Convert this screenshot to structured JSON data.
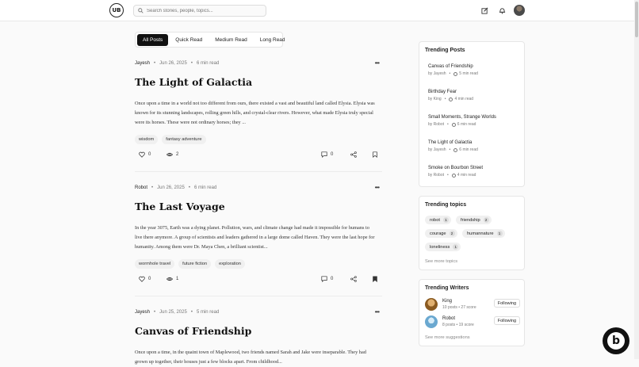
{
  "header": {
    "logo_text": "UB",
    "search_placeholder": "Search stories, people, topics..."
  },
  "filters": [
    "All Posts",
    "Quick Read",
    "Medium Read",
    "Long Read"
  ],
  "posts": [
    {
      "author": "Jayesh",
      "date": "Jun 26, 2025",
      "read": "6 min read",
      "title": "The Light of Galactia",
      "excerpt": "Once upon a time in a world not too different from ours, there existed a vast and beautiful land called Elysia. Elysia was known for its stunning landscapes, rolling green hills, and crystal-clear rivers. However, what made Elysia truly special were its horses. These were not ordinary horses; they ...",
      "tags": [
        "wisdom",
        "fantasy adventure"
      ],
      "likes": "0",
      "views": "2",
      "comments": "0"
    },
    {
      "author": "Robot",
      "date": "Jun 26, 2025",
      "read": "6 min read",
      "title": "The Last Voyage",
      "excerpt": "In the year 3075, Earth was a dying planet. Pollution, wars, and climate change had made it impossible for humans to live there anymore. A group of scientists and leaders gathered in a large dome called Haven. They were the last hope for humanity. Among them were Dr. Maya Chen, a brilliant scientist...",
      "tags": [
        "wormhole travel",
        "future fiction",
        "exploration"
      ],
      "likes": "0",
      "views": "1",
      "comments": "0"
    },
    {
      "author": "Jayesh",
      "date": "Jun 25, 2025",
      "read": "5 min read",
      "title": "Canvas of Friendship",
      "excerpt": "Once upon a time, in the quaint town of Maplewood, two friends named Sarah and Jake were inseparable. They had grown up together, their houses just a few blocks apart. From childhood...",
      "tags": [],
      "likes": "",
      "views": "",
      "comments": ""
    }
  ],
  "trending_posts": {
    "title": "Trending Posts",
    "items": [
      {
        "title": "Canvas of Friendship",
        "by": "by Jayesh",
        "read": "5 min read"
      },
      {
        "title": "Birthday Fear",
        "by": "by King",
        "read": "4 min read"
      },
      {
        "title": "Small Moments, Strange Worlds",
        "by": "by Robot",
        "read": "6 min read"
      },
      {
        "title": "The Light of Galactia",
        "by": "by Jayesh",
        "read": "6 min read"
      },
      {
        "title": "Smoke on Bourbon Street",
        "by": "by Robot",
        "read": "4 min read"
      }
    ]
  },
  "trending_topics": {
    "title": "Trending topics",
    "items": [
      {
        "name": "robot",
        "count": "1"
      },
      {
        "name": "friendship",
        "count": "2"
      },
      {
        "name": "courage",
        "count": "2"
      },
      {
        "name": "humannature",
        "count": "1"
      },
      {
        "name": "loneliness",
        "count": "1"
      }
    ],
    "see_more": "See more topics"
  },
  "trending_writers": {
    "title": "Trending Writers",
    "items": [
      {
        "name": "King",
        "stats": "10 posts  •  27 score",
        "button": "Following"
      },
      {
        "name": "Robot",
        "stats": "8 posts  •  19 score",
        "button": "Following"
      }
    ],
    "see_more": "See more suggestions"
  },
  "badge_letter": "b"
}
